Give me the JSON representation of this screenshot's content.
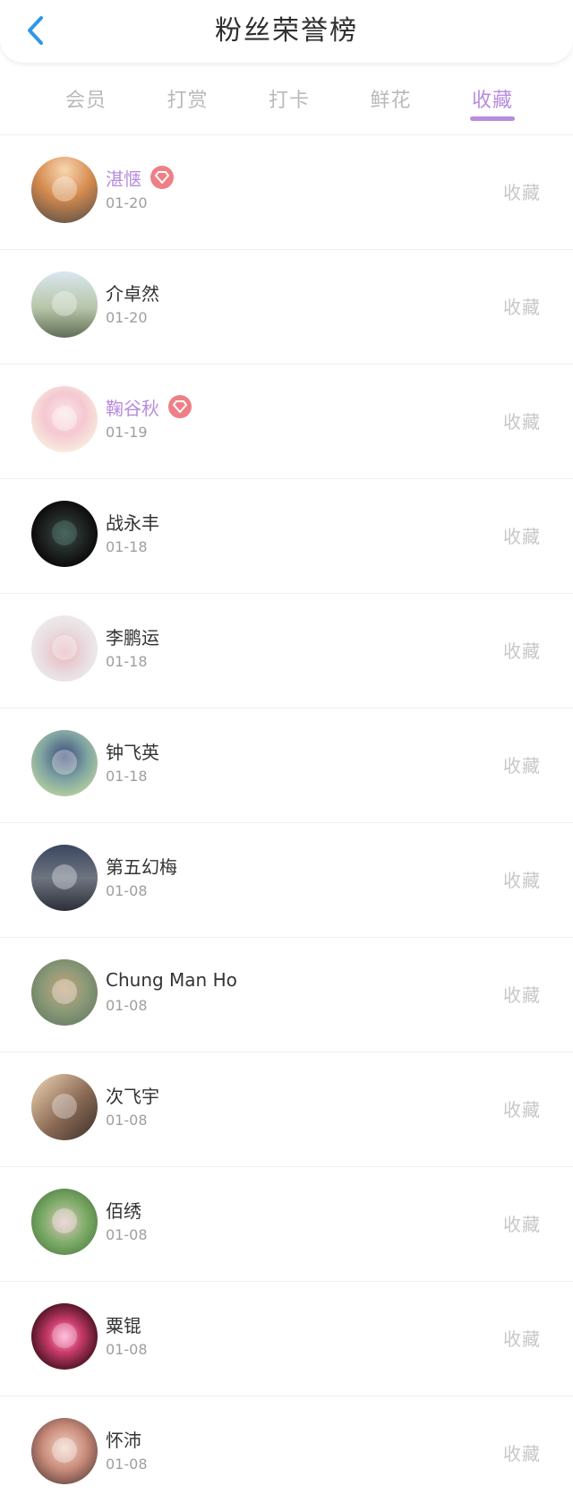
{
  "header": {
    "title": "粉丝荣誉榜",
    "back_icon": "chevron-left-icon"
  },
  "tabs": [
    {
      "label": "会员",
      "active": false
    },
    {
      "label": "打赏",
      "active": false
    },
    {
      "label": "打卡",
      "active": false
    },
    {
      "label": "鲜花",
      "active": false
    },
    {
      "label": "收藏",
      "active": true
    }
  ],
  "accent_color": "#b88cdf",
  "vip_badge_color": "#ef7f86",
  "fans": [
    {
      "name": "湛惬",
      "date": "01-20",
      "vip": true,
      "action": "收藏"
    },
    {
      "name": "介卓然",
      "date": "01-20",
      "vip": false,
      "action": "收藏"
    },
    {
      "name": "鞠谷秋",
      "date": "01-19",
      "vip": true,
      "action": "收藏"
    },
    {
      "name": "战永丰",
      "date": "01-18",
      "vip": false,
      "action": "收藏"
    },
    {
      "name": "李鹏运",
      "date": "01-18",
      "vip": false,
      "action": "收藏"
    },
    {
      "name": "钟飞英",
      "date": "01-18",
      "vip": false,
      "action": "收藏"
    },
    {
      "name": "第五幻梅",
      "date": "01-08",
      "vip": false,
      "action": "收藏"
    },
    {
      "name": "Chung Man Ho",
      "date": "01-08",
      "vip": false,
      "action": "收藏"
    },
    {
      "name": "次飞宇",
      "date": "01-08",
      "vip": false,
      "action": "收藏"
    },
    {
      "name": "佰绣",
      "date": "01-08",
      "vip": false,
      "action": "收藏"
    },
    {
      "name": "粟锟",
      "date": "01-08",
      "vip": false,
      "action": "收藏"
    },
    {
      "name": "怀沛",
      "date": "01-08",
      "vip": false,
      "action": "收藏"
    }
  ]
}
